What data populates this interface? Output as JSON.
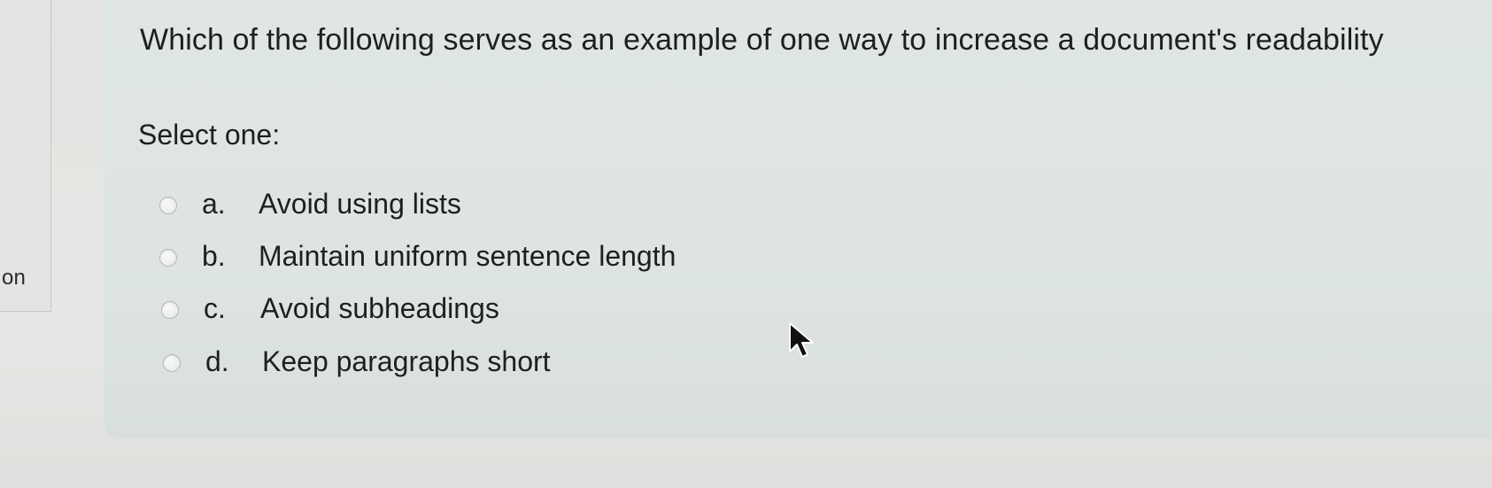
{
  "side_panel": {
    "label": "on"
  },
  "question": {
    "text": "Which of the following serves as an example of one way to increase a document's readability",
    "prompt": "Select one:",
    "options": [
      {
        "letter": "a.",
        "label": "Avoid using lists"
      },
      {
        "letter": "b.",
        "label": "Maintain uniform sentence length"
      },
      {
        "letter": "c.",
        "label": "Avoid subheadings"
      },
      {
        "letter": "d.",
        "label": "Keep paragraphs short"
      }
    ]
  },
  "icons": {
    "cursor": "mouse-pointer-icon",
    "radio": "radio-button-icon"
  },
  "colors": {
    "card_background": "#dfe6e4",
    "page_background": "#e4e5e2",
    "text": "#1f1f1f"
  }
}
